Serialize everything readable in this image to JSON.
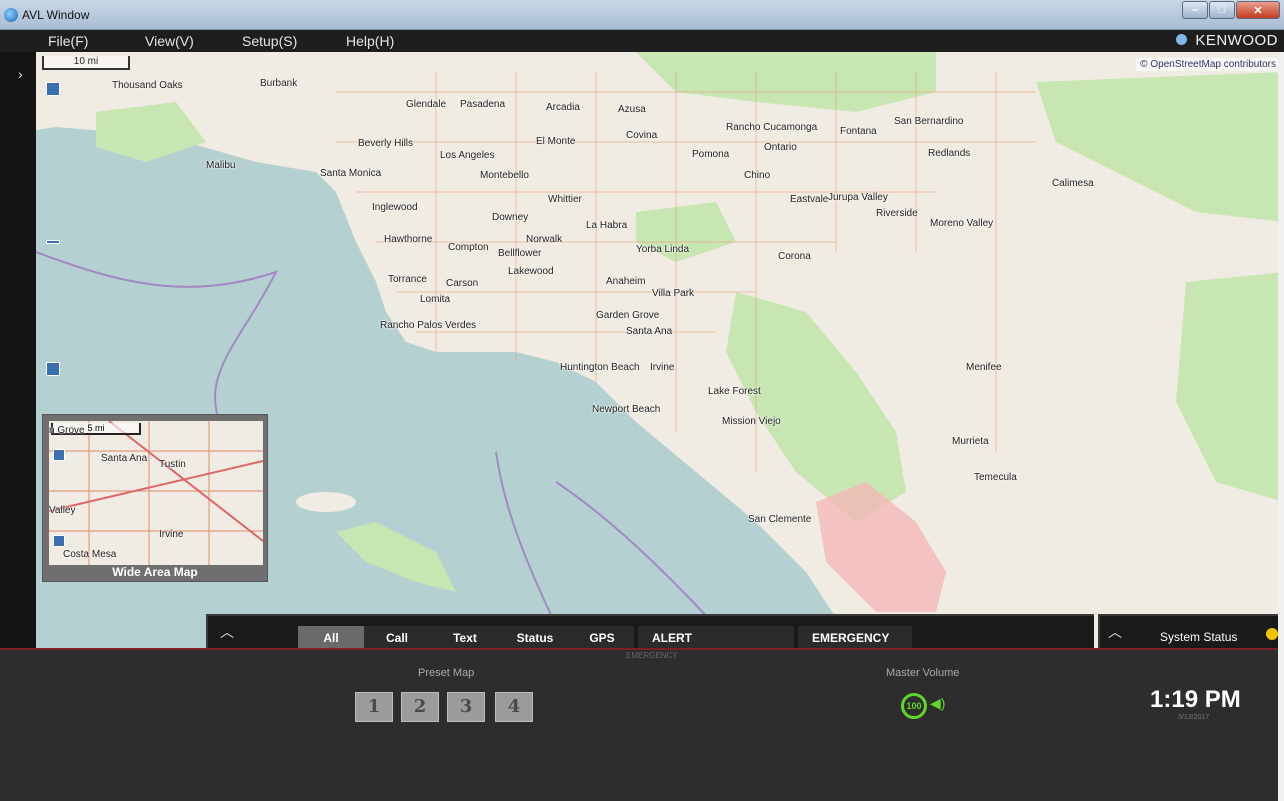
{
  "window": {
    "title": "AVL Window"
  },
  "menu": {
    "items": [
      {
        "label": "File(F)"
      },
      {
        "label": "View(V)"
      },
      {
        "label": "Setup(S)"
      },
      {
        "label": "Help(H)"
      }
    ],
    "brand": "KENWOOD"
  },
  "map": {
    "scale_label": "10 mi",
    "attribution": "© OpenStreetMap contributors",
    "cities": [
      "Burbank",
      "Glendale",
      "Pasadena",
      "Arcadia",
      "Azusa",
      "Covina",
      "Rancho Cucamonga",
      "Fontana",
      "San Bernardino",
      "Redlands",
      "Thousand Oaks",
      "Beverly Hills",
      "Los Angeles",
      "Malibu",
      "Santa Monica",
      "El Monte",
      "Pomona",
      "Ontario",
      "Chino",
      "Montebello",
      "Whittier",
      "Inglewood",
      "Downey",
      "La Habra",
      "Eastvale",
      "Jurupa Valley",
      "Riverside",
      "Moreno Valley",
      "Calimesa",
      "Hawthorne",
      "Compton",
      "Norwalk",
      "Bellflower",
      "Yorba Linda",
      "Corona",
      "Torrance",
      "Carson",
      "Lakewood",
      "Anaheim",
      "Villa Park",
      "Lomita",
      "Rancho Palos Verdes",
      "Garden Grove",
      "Santa Ana",
      "Huntington Beach",
      "Irvine",
      "Newport Beach",
      "Lake Forest",
      "Menifee",
      "Mission Viejo",
      "Murrieta",
      "Temecula",
      "San Clemente"
    ]
  },
  "inset": {
    "label": "Wide Area Map",
    "scale_label": "5 mi",
    "cities": [
      "n Grove",
      "Santa Ana",
      "Tustin",
      "Irvine",
      "Costa Mesa",
      "Valley"
    ]
  },
  "message_tabs": {
    "tabs": [
      {
        "label": "All",
        "active": true
      },
      {
        "label": "Call"
      },
      {
        "label": "Text"
      },
      {
        "label": "Status"
      },
      {
        "label": "GPS"
      },
      {
        "label": "ALERT"
      },
      {
        "label": "EMERGENCY"
      }
    ],
    "emergency_small": "EMERGENCY"
  },
  "system_status": {
    "label": "System Status"
  },
  "bottom": {
    "preset_label": "Preset Map",
    "presets": [
      "1",
      "2",
      "3",
      "4"
    ],
    "volume_label": "Master Volume",
    "volume_value": "100",
    "clock": "1:19 PM",
    "date": "3/13/2017"
  },
  "colors": {
    "accent_green": "#5fd62a",
    "warning": "#f2c200",
    "map_water": "#b5d0d0",
    "map_land": "#f0ebe3"
  }
}
